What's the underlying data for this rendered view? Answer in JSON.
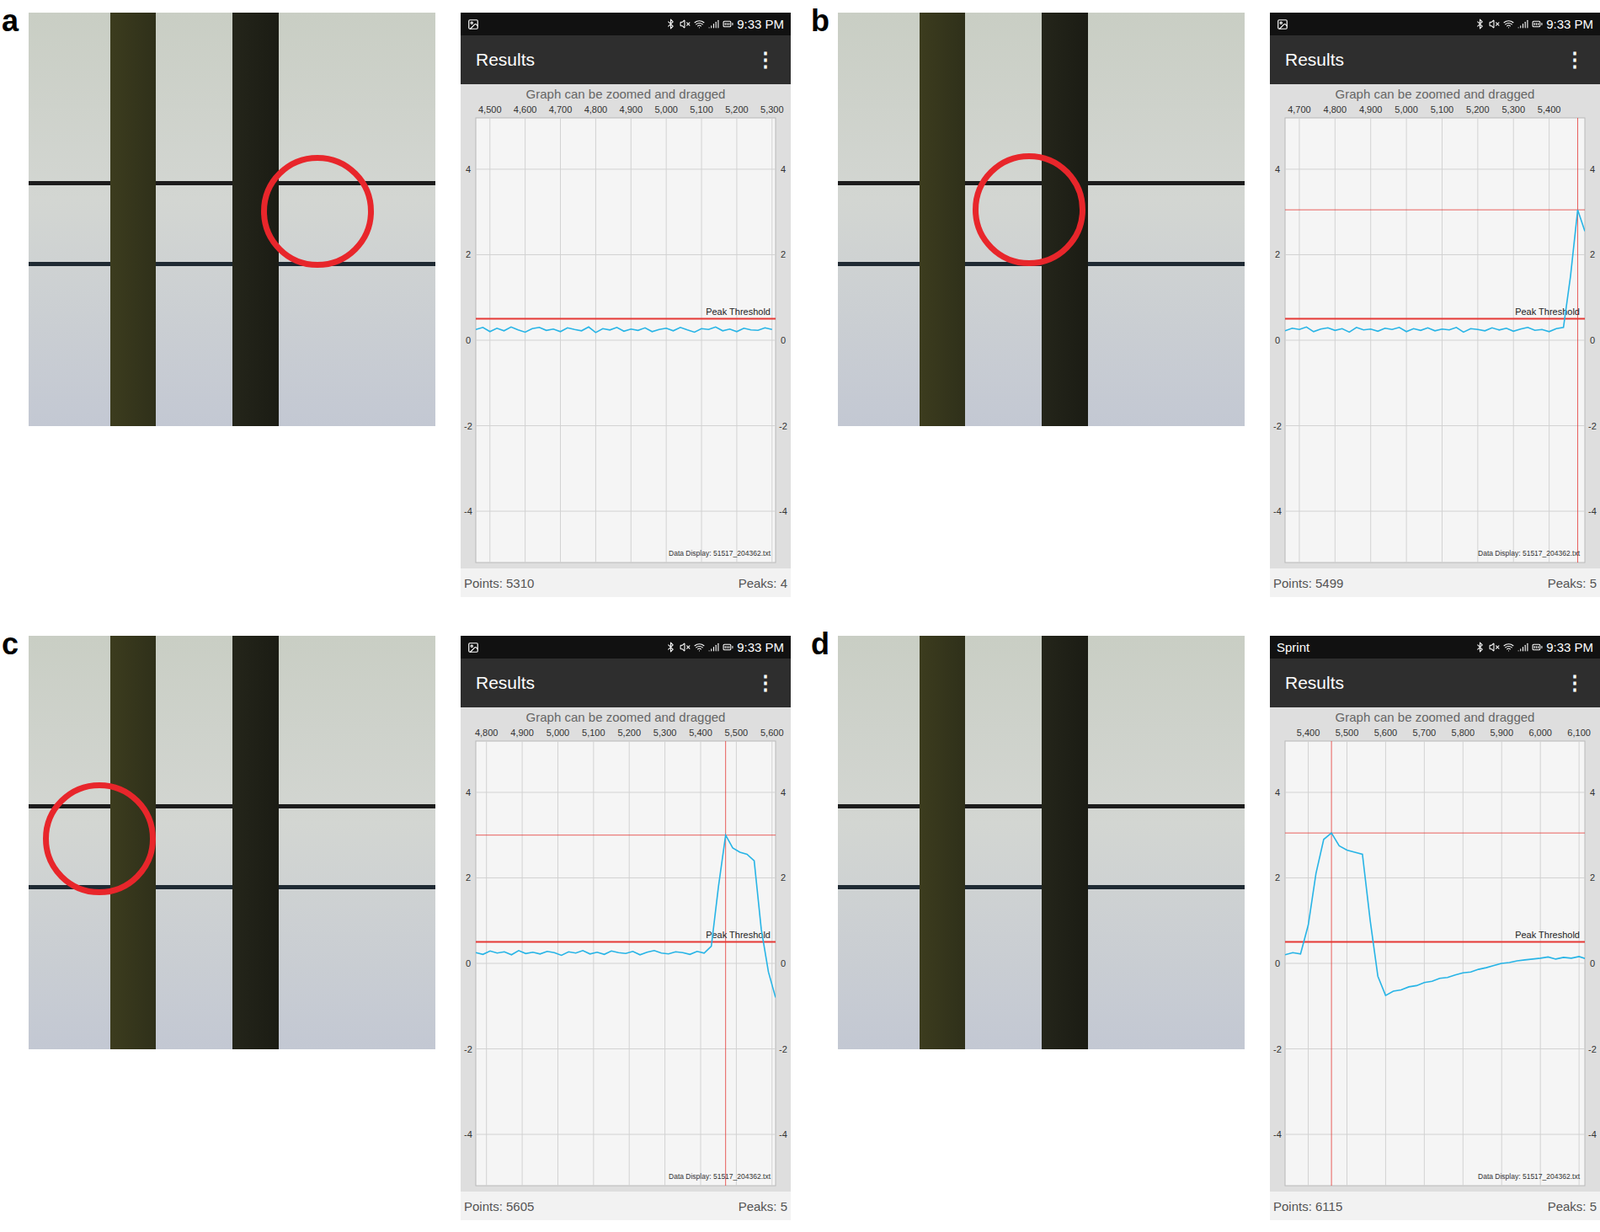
{
  "panels": [
    {
      "label": "a",
      "photo": {
        "highlight": true
      },
      "phone": {
        "status_bar": {
          "carrier": "",
          "image_notification": true,
          "time": "9:33 PM"
        },
        "title": "Results",
        "menu": "⋮",
        "hint": "Graph can be zoomed and dragged",
        "chart": {
          "x_ticks": [
            "4,500",
            "4,600",
            "4,700",
            "4,800",
            "4,900",
            "5,000",
            "5,100",
            "5,200",
            "5,300"
          ],
          "y_ticks": [
            "4",
            "2",
            "0",
            "-2",
            "-4"
          ],
          "x_range": [
            4460,
            5310
          ],
          "y_range": [
            -5.2,
            5.2
          ],
          "threshold": 0.5,
          "threshold_label": "Peak Threshold",
          "marker": null,
          "series": {
            "x_start": 4460,
            "x_step": 20,
            "values": [
              0.25,
              0.3,
              0.2,
              0.28,
              0.22,
              0.31,
              0.24,
              0.19,
              0.27,
              0.3,
              0.23,
              0.26,
              0.2,
              0.29,
              0.25,
              0.22,
              0.31,
              0.18,
              0.27,
              0.24,
              0.3,
              0.21,
              0.26,
              0.23,
              0.29,
              0.2,
              0.25,
              0.28,
              0.22,
              0.3,
              0.24,
              0.19,
              0.27,
              0.25,
              0.31,
              0.22,
              0.26,
              0.2,
              0.28,
              0.24,
              0.23,
              0.29,
              0.25
            ]
          },
          "file_label": "Data Display: 51517_204362.txt"
        },
        "points": "Points: 5310",
        "peaks": "Peaks: 4"
      }
    },
    {
      "label": "b",
      "photo": {
        "highlight": true
      },
      "phone": {
        "status_bar": {
          "carrier": "",
          "image_notification": true,
          "time": "9:33 PM"
        },
        "title": "Results",
        "menu": "⋮",
        "hint": "Graph can be zoomed and dragged",
        "chart": {
          "x_ticks": [
            "4,700",
            "4,800",
            "4,900",
            "5,000",
            "5,100",
            "5,200",
            "5,300",
            "5,400"
          ],
          "y_ticks": [
            "4",
            "2",
            "0",
            "-2",
            "-4"
          ],
          "x_range": [
            4660,
            5500
          ],
          "y_range": [
            -5.2,
            5.2
          ],
          "threshold": 0.5,
          "threshold_label": "Peak Threshold",
          "marker": {
            "x": 5480,
            "y": 3.05
          },
          "series": {
            "x_start": 4660,
            "x_step": 20,
            "values": [
              0.22,
              0.28,
              0.25,
              0.31,
              0.2,
              0.26,
              0.29,
              0.23,
              0.27,
              0.19,
              0.3,
              0.24,
              0.26,
              0.21,
              0.28,
              0.25,
              0.3,
              0.2,
              0.27,
              0.23,
              0.29,
              0.22,
              0.26,
              0.24,
              0.3,
              0.19,
              0.27,
              0.25,
              0.22,
              0.29,
              0.24,
              0.28,
              0.21,
              0.26,
              0.3,
              0.23,
              0.25,
              0.2,
              0.27,
              0.3,
              1.5,
              3.05,
              2.55
            ]
          },
          "file_label": "Data Display: 51517_204362.txt"
        },
        "points": "Points: 5499",
        "peaks": "Peaks: 5"
      }
    },
    {
      "label": "c",
      "photo": {
        "highlight": true
      },
      "phone": {
        "status_bar": {
          "carrier": "",
          "image_notification": true,
          "time": "9:33 PM"
        },
        "title": "Results",
        "menu": "⋮",
        "hint": "Graph can be zoomed and dragged",
        "chart": {
          "x_ticks": [
            "4,800",
            "4,900",
            "5,000",
            "5,100",
            "5,200",
            "5,300",
            "5,400",
            "5,500",
            "5,600"
          ],
          "y_ticks": [
            "4",
            "2",
            "0",
            "-2",
            "-4"
          ],
          "x_range": [
            4770,
            5610
          ],
          "y_range": [
            -5.2,
            5.2
          ],
          "threshold": 0.5,
          "threshold_label": "Peak Threshold",
          "marker": {
            "x": 5470,
            "y": 3.0
          },
          "series": {
            "x_start": 4770,
            "x_step": 20,
            "values": [
              0.25,
              0.21,
              0.29,
              0.24,
              0.27,
              0.2,
              0.3,
              0.23,
              0.26,
              0.22,
              0.28,
              0.25,
              0.19,
              0.27,
              0.24,
              0.3,
              0.22,
              0.26,
              0.21,
              0.29,
              0.25,
              0.23,
              0.28,
              0.2,
              0.26,
              0.3,
              0.24,
              0.22,
              0.27,
              0.25,
              0.21,
              0.28,
              0.24,
              0.4,
              1.8,
              3.0,
              2.7,
              2.6,
              2.55,
              2.4,
              0.8,
              -0.2,
              -0.8
            ]
          },
          "file_label": "Data Display: 51517_204362.txt"
        },
        "points": "Points: 5605",
        "peaks": "Peaks: 5"
      }
    },
    {
      "label": "d",
      "photo": {
        "highlight": false
      },
      "phone": {
        "status_bar": {
          "carrier": "Sprint",
          "image_notification": false,
          "time": "9:33 PM"
        },
        "title": "Results",
        "menu": "⋮",
        "hint": "Graph can be zoomed and dragged",
        "chart": {
          "x_ticks": [
            "5,400",
            "5,500",
            "5,600",
            "5,700",
            "5,800",
            "5,900",
            "6,000",
            "6,100"
          ],
          "y_ticks": [
            "4",
            "2",
            "0",
            "-2",
            "-4"
          ],
          "x_range": [
            5340,
            6115
          ],
          "y_range": [
            -5.2,
            5.2
          ],
          "threshold": 0.5,
          "threshold_label": "Peak Threshold",
          "marker": {
            "x": 5460,
            "y": 3.05
          },
          "series": {
            "x_start": 5340,
            "x_step": 20,
            "values": [
              0.2,
              0.25,
              0.22,
              0.9,
              2.1,
              2.9,
              3.05,
              2.75,
              2.65,
              2.6,
              2.55,
              1.0,
              -0.3,
              -0.75,
              -0.65,
              -0.62,
              -0.55,
              -0.52,
              -0.45,
              -0.42,
              -0.35,
              -0.33,
              -0.27,
              -0.22,
              -0.2,
              -0.14,
              -0.1,
              -0.05,
              0.0,
              0.02,
              0.06,
              0.08,
              0.1,
              0.12,
              0.15,
              0.1,
              0.14,
              0.12,
              0.16,
              0.1
            ]
          },
          "file_label": "Data Display: 51517_204362.txt"
        },
        "points": "Points: 6115",
        "peaks": "Peaks: 5"
      }
    }
  ]
}
